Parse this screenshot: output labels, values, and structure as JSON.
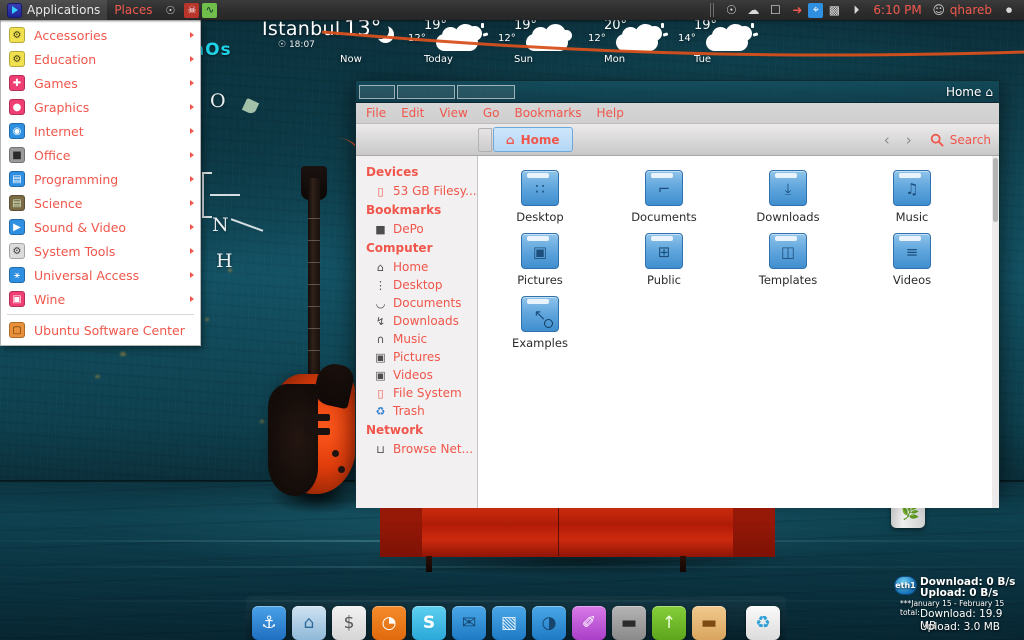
{
  "top_panel": {
    "applications_label": "Applications",
    "places_label": "Places",
    "tray": {
      "time": "6:10 PM",
      "user": "qhareb",
      "icons": [
        "gear-settings-icon",
        "cloud-icon",
        "chat-bubble-icon",
        "bluetooth-off-icon",
        "bluetooth-icon",
        "signal-bars-icon",
        "power-icon"
      ]
    },
    "panel_icons": [
      "skull-icon",
      "activity-monitor-icon",
      "search-dot-icon"
    ]
  },
  "apps_menu": {
    "items": [
      {
        "label": "Accessories",
        "icon": "gear-icon",
        "color": "#f2e14e",
        "submenu": true
      },
      {
        "label": "Education",
        "icon": "gear-icon",
        "color": "#f2e14e",
        "submenu": true
      },
      {
        "label": "Games",
        "icon": "gamepad-icon",
        "color": "#ef3f72",
        "submenu": true
      },
      {
        "label": "Graphics",
        "icon": "palette-icon",
        "color": "#ef3f72",
        "submenu": true
      },
      {
        "label": "Internet",
        "icon": "globe-icon",
        "color": "#2f8fe0",
        "submenu": true
      },
      {
        "label": "Office",
        "icon": "document-icon",
        "color": "#9a9a9a",
        "submenu": true
      },
      {
        "label": "Programming",
        "icon": "terminal-icon",
        "color": "#2f8fe0",
        "submenu": true
      },
      {
        "label": "Science",
        "icon": "board-icon",
        "color": "#7a6a46",
        "submenu": true
      },
      {
        "label": "Sound & Video",
        "icon": "play-icon",
        "color": "#2f8fe0",
        "submenu": true
      },
      {
        "label": "System Tools",
        "icon": "gear-icon",
        "color": "#cfcfcf",
        "submenu": true
      },
      {
        "label": "Universal Access",
        "icon": "accessibility-icon",
        "color": "#2f8fe0",
        "submenu": true
      },
      {
        "label": "Wine",
        "icon": "wine-window-icon",
        "color": "#ef3f72",
        "submenu": true
      }
    ],
    "footer_item": {
      "label": "Ubuntu Software Center",
      "icon": "software-center-icon",
      "color": "#e8913a",
      "submenu": false
    }
  },
  "weather": {
    "city": "Istanbul",
    "current_temp": "13°",
    "observation_time": "18:07",
    "now_label": "Now",
    "now_icon": "moon-icon",
    "forecast": [
      {
        "label": "Today",
        "high": "19°",
        "low": "12°",
        "icon": "sun-cloud-icon"
      },
      {
        "label": "Sun",
        "high": "19°",
        "low": "12°",
        "icon": "cloud-icon"
      },
      {
        "label": "Mon",
        "high": "20°",
        "low": "12°",
        "icon": "sun-cloud-icon"
      },
      {
        "label": "Tue",
        "high": "19°",
        "low": "14°",
        "icon": "sun-cloud-icon"
      }
    ]
  },
  "file_manager": {
    "window_title": "Home",
    "menubar": [
      "File",
      "Edit",
      "View",
      "Go",
      "Bookmarks",
      "Help"
    ],
    "breadcrumb": {
      "label": "Home",
      "icon": "home-icon"
    },
    "search_label": "Search",
    "nav_back": "‹",
    "nav_forward": "›",
    "sidebar": [
      {
        "type": "header",
        "label": "Devices"
      },
      {
        "type": "item",
        "label": "53 GB Filesy...",
        "icon": "drive-icon"
      },
      {
        "type": "header",
        "label": "Bookmarks"
      },
      {
        "type": "item",
        "label": "DePo",
        "icon": "folder-dark-icon"
      },
      {
        "type": "header",
        "label": "Computer"
      },
      {
        "type": "item",
        "label": "Home",
        "icon": "home-icon"
      },
      {
        "type": "item",
        "label": "Desktop",
        "icon": "desktop-icon"
      },
      {
        "type": "item",
        "label": "Documents",
        "icon": "documents-icon"
      },
      {
        "type": "item",
        "label": "Downloads",
        "icon": "downloads-icon"
      },
      {
        "type": "item",
        "label": "Music",
        "icon": "headphones-icon"
      },
      {
        "type": "item",
        "label": "Pictures",
        "icon": "picture-icon"
      },
      {
        "type": "item",
        "label": "Videos",
        "icon": "video-icon"
      },
      {
        "type": "item",
        "label": "File System",
        "icon": "filesystem-icon"
      },
      {
        "type": "item",
        "label": "Trash",
        "icon": "trash-icon"
      },
      {
        "type": "header",
        "label": "Network"
      },
      {
        "type": "item",
        "label": "Browse Net...",
        "icon": "network-icon"
      }
    ],
    "files": [
      {
        "name": "Desktop",
        "icon": "folder-desktop-icon",
        "glyph": "∷"
      },
      {
        "name": "Documents",
        "icon": "folder-documents-icon",
        "glyph": "⌐"
      },
      {
        "name": "Downloads",
        "icon": "folder-downloads-icon",
        "glyph": "⤓"
      },
      {
        "name": "Music",
        "icon": "folder-music-icon",
        "glyph": "♫"
      },
      {
        "name": "Pictures",
        "icon": "folder-pictures-icon",
        "glyph": "▣"
      },
      {
        "name": "Public",
        "icon": "folder-public-icon",
        "glyph": "⊞"
      },
      {
        "name": "Templates",
        "icon": "folder-templates-icon",
        "glyph": "◫"
      },
      {
        "name": "Videos",
        "icon": "folder-videos-icon",
        "glyph": "≡"
      },
      {
        "name": "Examples",
        "icon": "folder-examples-link-icon",
        "glyph": "↖"
      }
    ]
  },
  "desktop": {
    "trash_label": "",
    "wall_text_teal": "nOs",
    "wall_text_glyphs": [
      "O",
      "N",
      "H",
      "H"
    ]
  },
  "conky": {
    "interface": "eth1",
    "download_rate": "Download: 0 B/s",
    "upload_rate": "Upload: 0 B/s",
    "total_period": "***January 15 - February 15 total:",
    "download_total": "Download: 19.9 MB",
    "upload_total": "Upload: 3.0 MB"
  },
  "dock": {
    "items": [
      {
        "name": "docky-anchor",
        "glyph": "⚓",
        "bg": "linear-gradient(180deg,#4aa2e8,#1f6fc0)",
        "running": true
      },
      {
        "name": "home-folder",
        "glyph": "⌂",
        "bg": "linear-gradient(180deg,#cfe3f2,#8fb9d8)",
        "running": false
      },
      {
        "name": "terminal",
        "glyph": "$",
        "bg": "linear-gradient(180deg,#f2f2f2,#d6d6d6)",
        "running": false
      },
      {
        "name": "firefox",
        "glyph": "◔",
        "bg": "linear-gradient(180deg,#f58b2a,#e06a0d)",
        "running": true
      },
      {
        "name": "skype",
        "glyph": "S",
        "bg": "linear-gradient(180deg,#5ed0f0,#2aa8d8)",
        "running": false
      },
      {
        "name": "mail",
        "glyph": "✉",
        "bg": "linear-gradient(180deg,#4aa8e8,#1e7ac4)",
        "running": false
      },
      {
        "name": "text-editor",
        "glyph": "▧",
        "bg": "linear-gradient(180deg,#4aa8e8,#1e7ac4)",
        "running": false
      },
      {
        "name": "web-browser",
        "glyph": "◑",
        "bg": "linear-gradient(180deg,#4aa8e8,#1e7ac4)",
        "running": false
      },
      {
        "name": "paint",
        "glyph": "✐",
        "bg": "linear-gradient(180deg,#d97ae8,#a93ec8)",
        "running": false
      },
      {
        "name": "toggle-switch",
        "glyph": "▬",
        "bg": "linear-gradient(180deg,#b4b4b4,#8a8a8a)",
        "running": false
      },
      {
        "name": "updater",
        "glyph": "↑",
        "bg": "linear-gradient(180deg,#86cf3a,#5da51c)",
        "running": false
      },
      {
        "name": "file-manager",
        "glyph": "▬",
        "bg": "linear-gradient(180deg,#f0c98e,#d9a55e)",
        "running": true
      },
      {
        "name": "trash",
        "glyph": "♻",
        "bg": "linear-gradient(180deg,#fafafa,#dcdcdc)",
        "running": false
      }
    ]
  }
}
